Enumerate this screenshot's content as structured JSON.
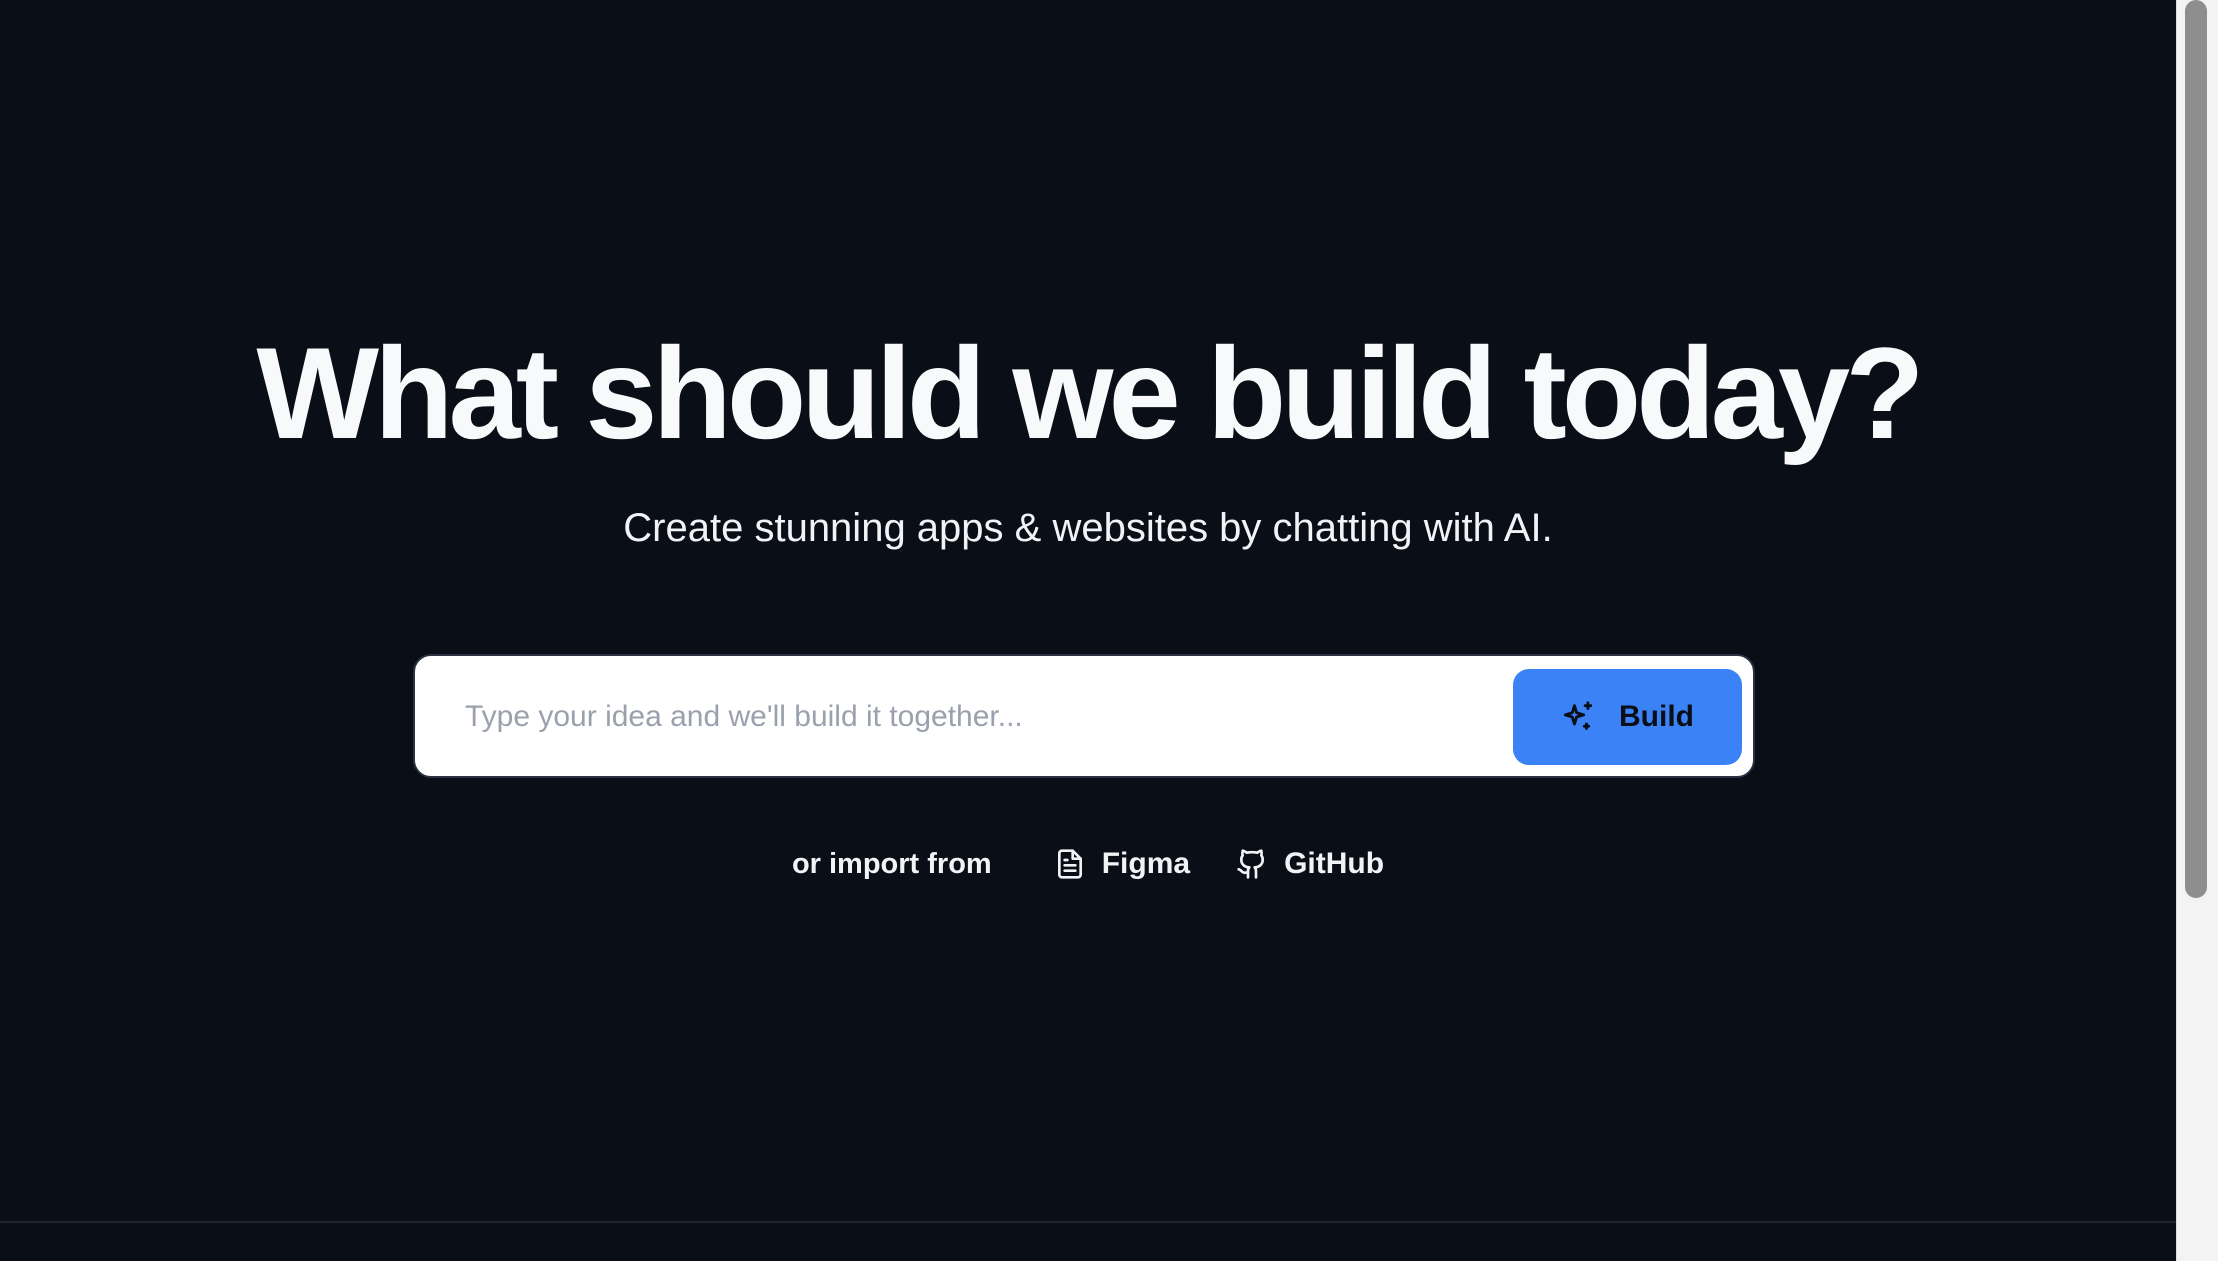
{
  "hero": {
    "title": "What should we build today?",
    "subtitle": "Create stunning apps & websites by chatting with AI."
  },
  "prompt": {
    "placeholder": "Type your idea and we'll build it together...",
    "value": "",
    "build_button_label": "Build",
    "build_icon": "sparkles-icon"
  },
  "import": {
    "label": "or import from",
    "sources": [
      {
        "label": "Figma",
        "icon": "file-text-icon"
      },
      {
        "label": "GitHub",
        "icon": "github-icon"
      }
    ]
  },
  "colors": {
    "background": "#0a0e17",
    "accent": "#3b82f6",
    "text": "#f8f9fb",
    "placeholder": "#9aa1ad"
  }
}
